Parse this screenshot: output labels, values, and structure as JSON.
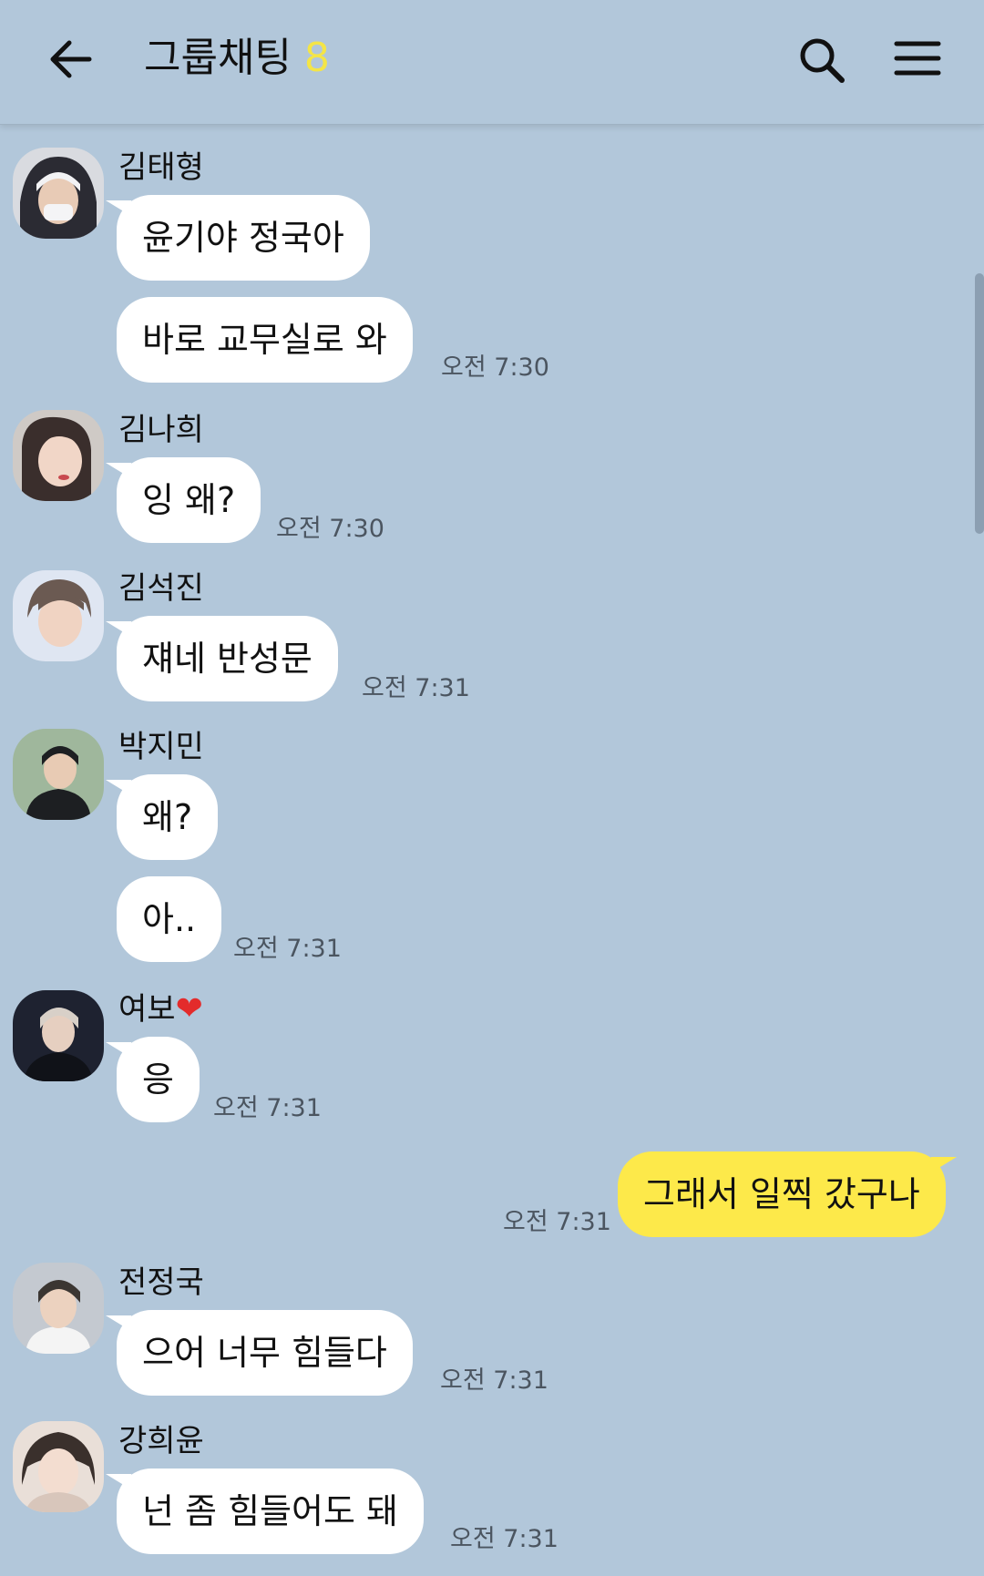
{
  "header": {
    "title": "그룹채팅",
    "member_count": "8",
    "back_icon": "arrow-left-icon",
    "search_icon": "search-icon",
    "menu_icon": "hamburger-menu-icon"
  },
  "messages": [
    {
      "sender": "김태형",
      "bubbles": [
        "윤기야 정국아",
        "바로 교무실로 와"
      ],
      "time": "오전 7:30",
      "avatar_color": "#2b2b33"
    },
    {
      "sender": "김나희",
      "bubbles": [
        "잉 왜?"
      ],
      "time": "오전 7:30",
      "avatar_color": "#3a2e2c"
    },
    {
      "sender": "김석진",
      "bubbles": [
        "쟤네 반성문"
      ],
      "time": "오전 7:31",
      "avatar_color": "#6b5a52"
    },
    {
      "sender": "박지민",
      "bubbles": [
        "왜?",
        "아.."
      ],
      "time": "오전 7:31",
      "avatar_color": "#4d5c4e"
    },
    {
      "sender": "여보",
      "sender_suffix": "❤",
      "bubbles": [
        "응"
      ],
      "time": "오전 7:31",
      "avatar_color": "#1e2230"
    },
    {
      "sender": "",
      "mine": true,
      "bubbles": [
        "그래서 일찍 갔구나"
      ],
      "time": "오전 7:31"
    },
    {
      "sender": "전정국",
      "bubbles": [
        "으어 너무 힘들다"
      ],
      "time": "오전 7:31",
      "avatar_color": "#3b3632"
    },
    {
      "sender": "강희윤",
      "bubbles": [
        "넌 좀 힘들어도 돼"
      ],
      "time": "오전 7:31",
      "avatar_color": "#d8c6bb"
    }
  ],
  "colors": {
    "background": "#b2c7da",
    "bubble_other": "#ffffff",
    "bubble_mine": "#fde94a",
    "member_count": "#f4e547"
  }
}
